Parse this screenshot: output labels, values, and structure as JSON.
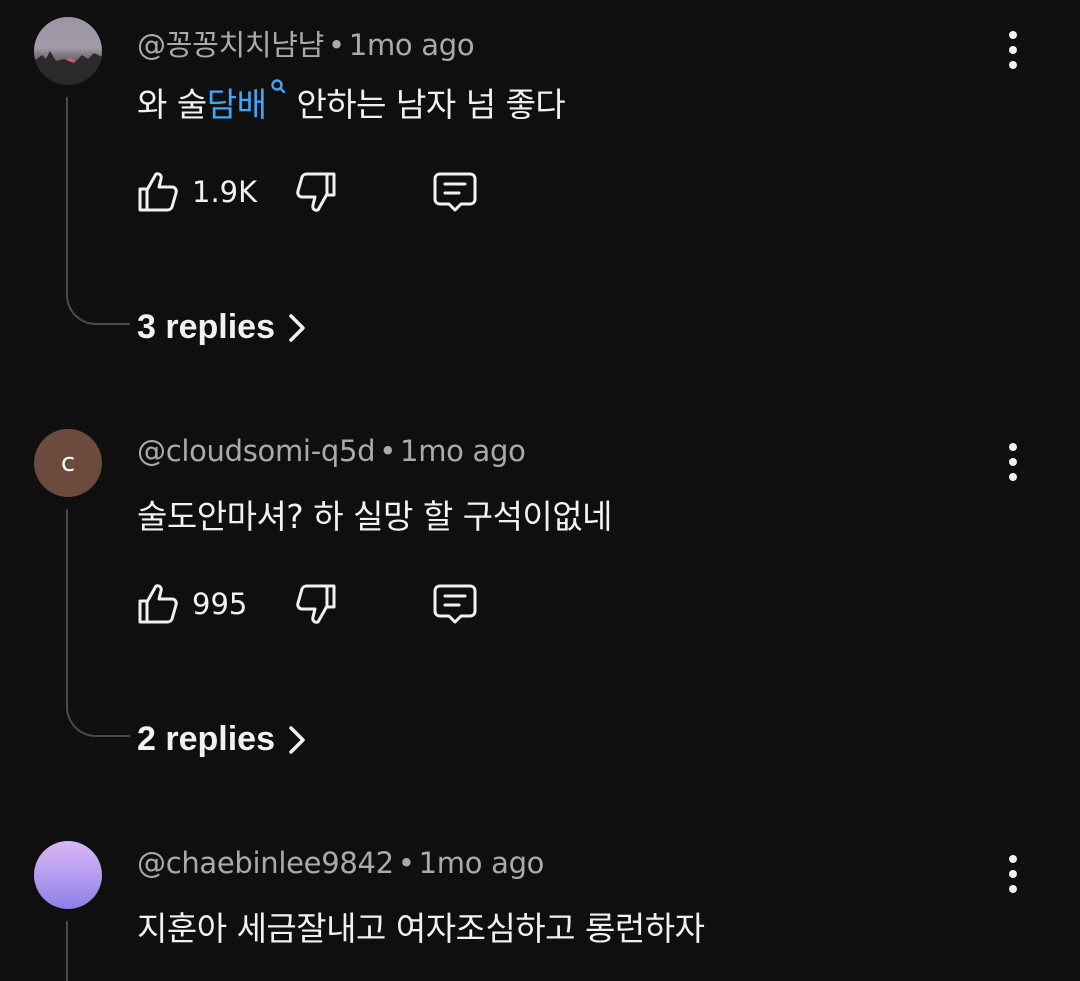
{
  "comments": [
    {
      "avatar": {
        "type": "image",
        "description": "sunset-landscape"
      },
      "handle": "@꽁꽁치치냠냠",
      "separator": "•",
      "time": "1mo ago",
      "text_before": "와 술",
      "text_link": "담배",
      "text_after": " 안하는 남자 넘 좋다",
      "likes": "1.9K",
      "replies_label": "3 replies",
      "link_color": "#3ea6ff"
    },
    {
      "avatar": {
        "type": "letter",
        "letter": "c",
        "color": "#6d4a3e"
      },
      "handle": "@cloudsomi-q5d",
      "separator": "•",
      "time": "1mo ago",
      "text": "술도안마셔? 하  실망 할 구석이없네",
      "likes": "995",
      "replies_label": "2 replies"
    },
    {
      "avatar": {
        "type": "image",
        "description": "purple-gradient"
      },
      "handle": "@chaebinlee9842",
      "separator": "•",
      "time": "1mo ago",
      "text": "지훈아 세금잘내고 여자조심하고 롱런하자"
    }
  ],
  "icons": {
    "like": "thumbs-up-icon",
    "dislike": "thumbs-down-icon",
    "reply": "reply-comment-icon",
    "more": "more-vertical-icon",
    "chevron": "chevron-right-icon",
    "search": "search-icon"
  },
  "colors": {
    "background": "#0f0f0f",
    "text": "#f1f1f1",
    "meta": "#aaaaaa",
    "link": "#3ea6ff"
  }
}
